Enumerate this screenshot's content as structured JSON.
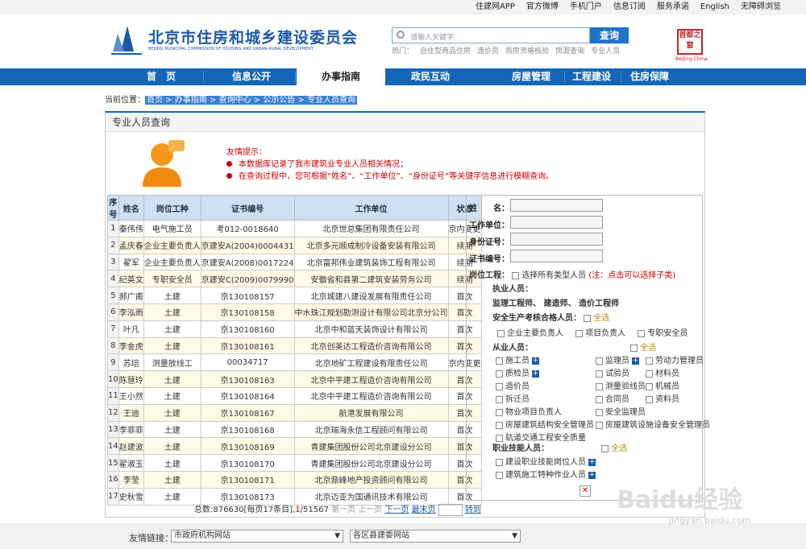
{
  "topbar": {
    "links": [
      "住建网APP",
      "官方微博",
      "手机门户",
      "信息订阅",
      "服务承诺",
      "English",
      "无障碍浏览"
    ]
  },
  "header": {
    "title": "北京市住房和城乡建设委员会",
    "subtitle": "BEIJING MUNICIPAL COMMISSION OF HOUSING AND URBAN-RURAL DEVELOPMENT",
    "search_placeholder": "请输入关键字",
    "search_button": "查询",
    "hot_label": "热门：",
    "hot_links": [
      "自住型商品住房",
      "造价员",
      "购房资格核验",
      "房源查询",
      "专业人员"
    ],
    "seal_text": "首都之窗",
    "seal_sub": "Beijing-China"
  },
  "nav": {
    "items": [
      "首　页",
      "信息公开",
      "办事指南",
      "政民互动",
      "房屋管理",
      "工程建设",
      "住房保障"
    ]
  },
  "breadcrumb": {
    "label": "当前位置：",
    "path": "首页 > 办事指南 > 查询中心 > 公示公告 > 专业人员查询"
  },
  "panel": {
    "title": "专业人员查询",
    "tip_title": "友情提示：",
    "tip_lines": [
      "本数据库记录了我市建筑业专业人员相关情况；",
      "在查询过程中，您可根据“姓名”、“工作单位”、“身份证号”等关键字信息进行模糊查询。"
    ]
  },
  "table": {
    "headers": [
      "序号",
      "姓名",
      "岗位工种",
      "证书编号",
      "工作单位",
      "状态"
    ],
    "rows": [
      [
        "1",
        "秦伟伟",
        "电气施工员",
        "考012-0018640",
        "北京世总集团有限责任公司",
        "京内变更"
      ],
      [
        "2",
        "孟庆春",
        "企业主要负责人",
        "京建安A(2004)0004431",
        "北京多元顺成制冷设备安装有限公司",
        "续期"
      ],
      [
        "3",
        "翟军",
        "企业主要负责人",
        "京建安A(2008)0017224",
        "北京富邦伟业建筑装饰工程有限公司",
        "续期"
      ],
      [
        "4",
        "纪英文",
        "专职安全员",
        "京建安C(2009)0079990",
        "安徽省和县第二建筑安装劳务公司",
        "续期"
      ],
      [
        "5",
        "郝广甫",
        "土建",
        "京130108157",
        "北京城建八建设发展有限责任公司",
        "首次"
      ],
      [
        "6",
        "李泓雨",
        "土建",
        "京130108158",
        "中水珠江规划勘测设计有限公司北京分公司",
        "首次"
      ],
      [
        "7",
        "叶凡",
        "土建",
        "京130108160",
        "北京中和蓝天装饰设计有限公司",
        "首次"
      ],
      [
        "8",
        "李金虎",
        "土建",
        "京130108161",
        "北京创美达工程造价咨询有限公司",
        "首次"
      ],
      [
        "9",
        "苏培",
        "测量放线工",
        "00034717",
        "北京地矿工程建设有限责任公司",
        "京内变更"
      ],
      [
        "10",
        "陈慧玲",
        "土建",
        "京130108163",
        "北京中平建工程造价咨询有限公司",
        "首次"
      ],
      [
        "11",
        "王小然",
        "土建",
        "京130108164",
        "北京中平建工程造价咨询有限公司",
        "首次"
      ],
      [
        "12",
        "王迪",
        "土建",
        "京130108167",
        "航港发展有限公司",
        "首次"
      ],
      [
        "13",
        "李菲菲",
        "土建",
        "京130108168",
        "北京瑞海永信工程顾问有限公司",
        "首次"
      ],
      [
        "14",
        "赵建波",
        "土建",
        "京130108169",
        "青建集团股份公司北京建设分公司",
        "首次"
      ],
      [
        "15",
        "翟淑玉",
        "土建",
        "京130108170",
        "青建集团股份公司北京建设分公司",
        "首次"
      ],
      [
        "16",
        "李莹",
        "土建",
        "京130108171",
        "北京鼎峰地产投资顾问有限公司",
        "首次"
      ],
      [
        "17",
        "史秋雪",
        "土建",
        "京130108173",
        "北京迈亚为国通讯技术有限公司",
        "首次"
      ]
    ]
  },
  "form": {
    "name_label": "姓　　名：",
    "unit_label": "工作单位：",
    "id_label": "身份证号：",
    "cert_label": "证书编号：",
    "post_label": "岗位工程：",
    "select_all_types": "选择所有类型人员",
    "hint": "(注：点击可以选择子类)",
    "practice": "执业人员：",
    "practice_list": "监理工程师、 建造师、 造价工程师",
    "safety": "安全生产考核合格人员：",
    "select_all": "全选",
    "safety_items": [
      "企业主要负责人",
      "项目负责人",
      "专职安全员"
    ],
    "staff": "从业人员：",
    "staff_items": [
      "施工员",
      "监理员",
      "劳动力管理员",
      "质检员",
      "试验员",
      "材料员",
      "造价员",
      "测量验线员",
      "机械员",
      "拆迁员",
      "合同员",
      "资料员",
      "物业项目负责人",
      "安全监理员",
      "房屋建筑结构安全管理员",
      "房屋建筑设施设备安全管理员",
      "轨道交通工程安全质量"
    ],
    "skill": "职业技能人员：",
    "skill_items": [
      "建设职业技能岗位人员",
      "建筑施工特种作业人员"
    ]
  },
  "pager": {
    "total": "总数:876630[每页17条目],",
    "current": "1",
    "pages": "/51567",
    "first": "第一页",
    "prev": "上一页",
    "next": "下一页",
    "last": "最末页",
    "go": "转到"
  },
  "footer": {
    "label": "友情链接：",
    "select1": "市政府机构网站",
    "select2": "各区县建委网站"
  },
  "watermark": {
    "main": "Baidu经验",
    "sub": "jingyan.baidu.com"
  },
  "colors": {
    "nav": "#1466b8",
    "accent": "#c00",
    "header_blue": "#1b5aa8"
  }
}
